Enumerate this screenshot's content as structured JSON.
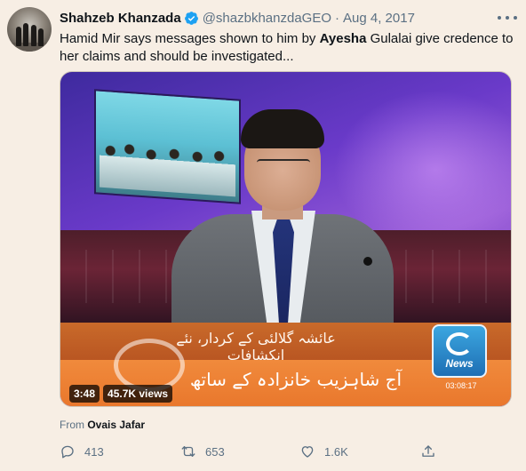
{
  "author": {
    "display_name": "Shahzeb Khanzada",
    "handle": "@shazbkhanzdaGEO",
    "separator": "·",
    "date": "Aug 4, 2017",
    "verified": true,
    "verified_color": "#1da1f2"
  },
  "tweet": {
    "text_before": "Hamid Mir says messages shown to him by ",
    "text_bold": "Ayesha",
    "text_after": " Gulalai give credence to her claims and should be investigated..."
  },
  "video": {
    "duration": "3:48",
    "views": "45.7K views",
    "lower_third_top": "عائشہ گلالئی کے کردار، نئے انکشافات",
    "lower_third_bottom": "آج شاہزیب خانزادہ کے ساتھ",
    "channel_logo": "News",
    "clock": "03:08:17"
  },
  "attribution": {
    "prefix": "From",
    "source": "Ovais Jafar"
  },
  "actions": {
    "replies": "413",
    "retweets": "653",
    "likes": "1.6K",
    "icons": [
      "reply-icon",
      "retweet-icon",
      "like-icon",
      "share-icon"
    ]
  },
  "colors": {
    "background": "#f7eee4",
    "secondary_text": "#5b7083",
    "primary_text": "#0f1419"
  }
}
